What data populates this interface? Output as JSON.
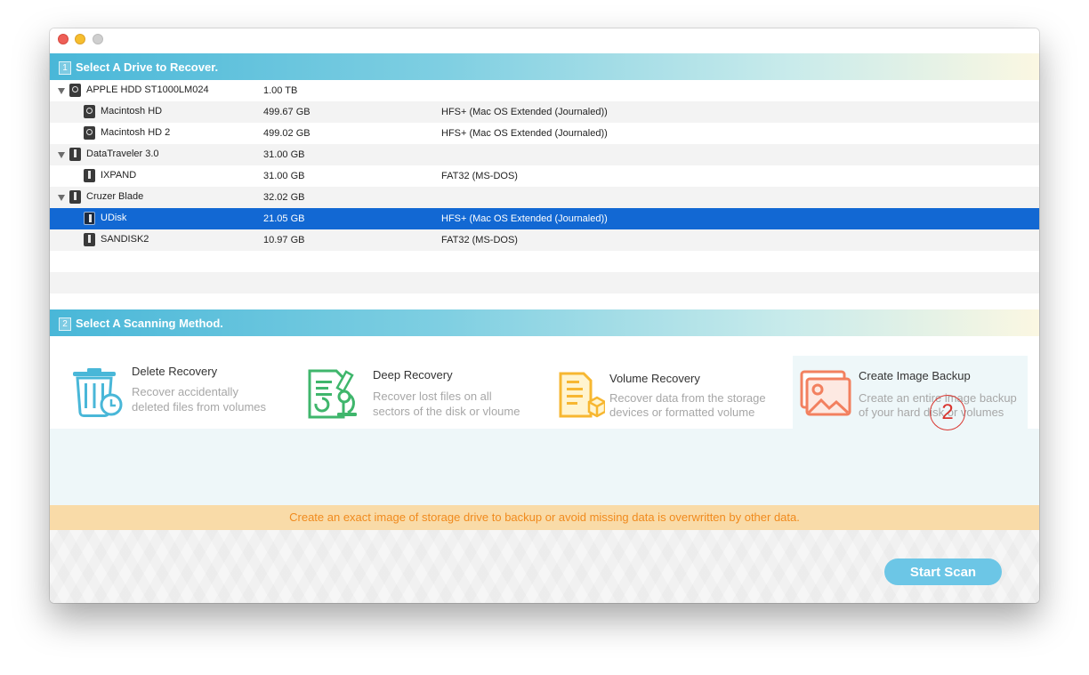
{
  "section1": {
    "number": "1",
    "title": "Select A Drive to Recover."
  },
  "drives": [
    {
      "name": "APPLE HDD ST1000LM024",
      "size": "1.00 TB",
      "fs": "",
      "type": "hdd",
      "level": 0
    },
    {
      "name": "Macintosh HD",
      "size": "499.67 GB",
      "fs": "HFS+ (Mac OS Extended (Journaled))",
      "type": "hdd",
      "level": 1
    },
    {
      "name": "Macintosh HD 2",
      "size": "499.02 GB",
      "fs": "HFS+ (Mac OS Extended (Journaled))",
      "type": "hdd",
      "level": 1
    },
    {
      "name": "DataTraveler 3.0",
      "size": "31.00 GB",
      "fs": "",
      "type": "usb",
      "level": 0
    },
    {
      "name": "IXPAND",
      "size": "31.00 GB",
      "fs": "FAT32 (MS-DOS)",
      "type": "usb",
      "level": 1
    },
    {
      "name": "Cruzer Blade",
      "size": "32.02 GB",
      "fs": "",
      "type": "usb",
      "level": 0
    },
    {
      "name": "UDisk",
      "size": "21.05 GB",
      "fs": "HFS+ (Mac OS Extended (Journaled))",
      "type": "usb",
      "level": 1,
      "selected": true
    },
    {
      "name": "SANDISK2",
      "size": "10.97 GB",
      "fs": "FAT32 (MS-DOS)",
      "type": "usb",
      "level": 1
    }
  ],
  "section2": {
    "number": "2",
    "title": "Select A Scanning Method."
  },
  "methods": {
    "delete": {
      "title": "Delete Recovery",
      "desc1": "Recover accidentally",
      "desc2": "deleted files from volumes",
      "icon": "trash-clock-icon"
    },
    "deep": {
      "title": "Deep Recovery",
      "desc1": "Recover lost files on all",
      "desc2": "sectors of the disk or vloume",
      "icon": "microscope-document-icon"
    },
    "volume": {
      "title": "Volume Recovery",
      "desc1": "Recover data from the storage",
      "desc2": "devices or formatted volume",
      "icon": "folder-box-icon"
    },
    "image": {
      "title": "Create Image Backup",
      "desc1": "Create an entire image backup",
      "desc2": "of your hard disk or volumes",
      "icon": "image-icon"
    }
  },
  "annotation": "2",
  "notice": "Create an exact image of storage drive to backup or avoid missing data is overwritten by other data.",
  "start_button": "Start Scan",
  "colors": {
    "accent": "#1268d3",
    "header_start": "#49b7d8",
    "notice_bg": "#f9dba8",
    "notice_text": "#f08a1d",
    "button": "#6cc6e6",
    "annotation": "#d9352f"
  }
}
